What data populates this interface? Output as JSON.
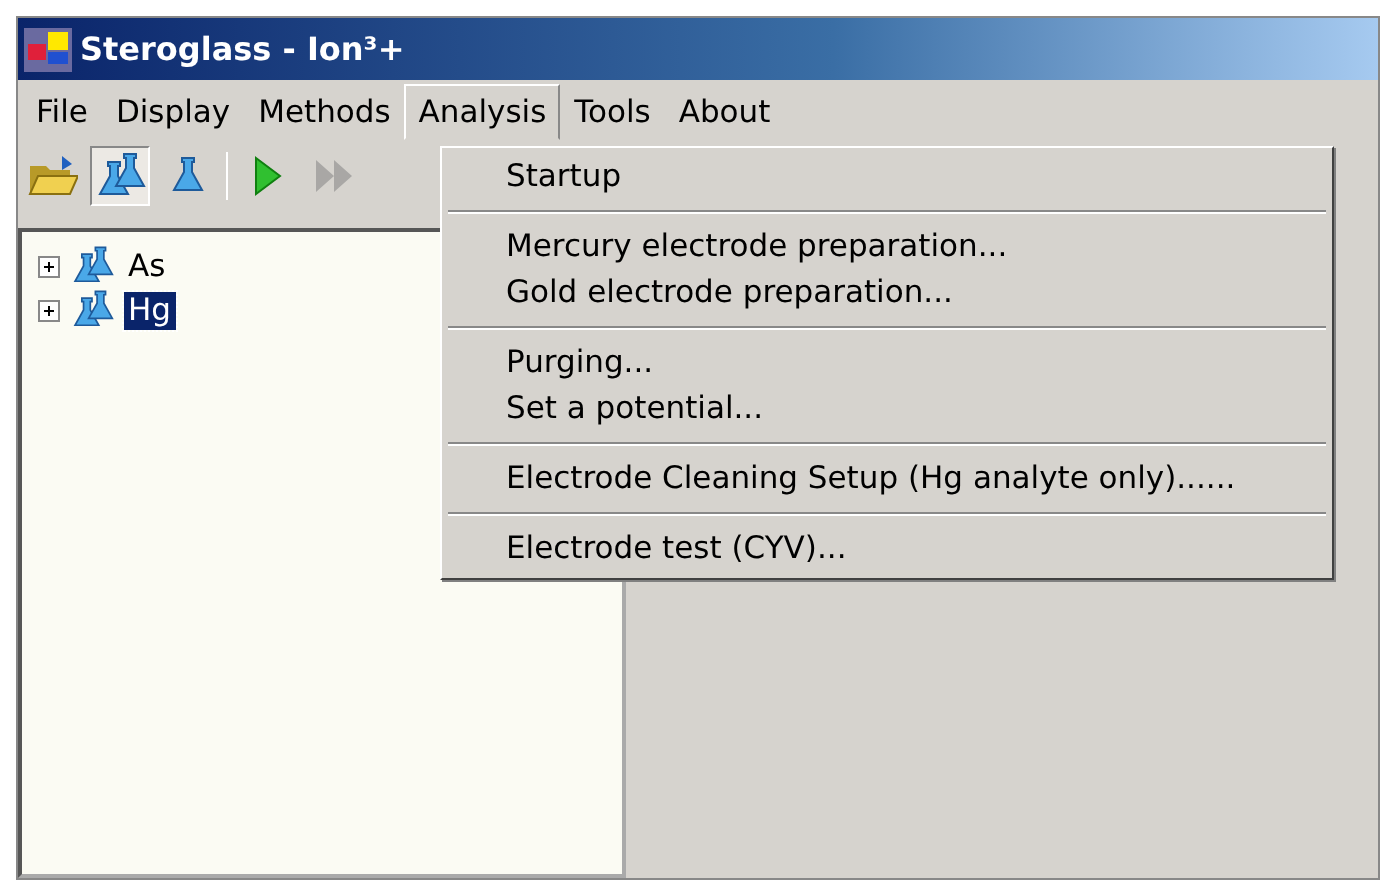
{
  "window": {
    "title": "Steroglass - Ion³+"
  },
  "menubar": [
    {
      "label": "File",
      "selected": false
    },
    {
      "label": "Display",
      "selected": false
    },
    {
      "label": "Methods",
      "selected": false
    },
    {
      "label": "Analysis",
      "selected": true
    },
    {
      "label": "Tools",
      "selected": false
    },
    {
      "label": "About",
      "selected": false
    }
  ],
  "toolbar": [
    {
      "kind": "open",
      "pressed": false,
      "disabled": false
    },
    {
      "kind": "flasks",
      "pressed": true,
      "disabled": false
    },
    {
      "kind": "flask",
      "pressed": false,
      "disabled": false
    },
    {
      "kind": "separator"
    },
    {
      "kind": "play",
      "pressed": false,
      "disabled": false
    },
    {
      "kind": "forward",
      "pressed": false,
      "disabled": true
    }
  ],
  "tree": [
    {
      "label": "As",
      "expanded": false,
      "selected": false
    },
    {
      "label": "Hg",
      "expanded": false,
      "selected": true
    }
  ],
  "dropdown": {
    "groups": [
      [
        "Startup"
      ],
      [
        "Mercury electrode preparation...",
        "Gold electrode preparation..."
      ],
      [
        "Purging...",
        "Set a potential..."
      ],
      [
        "Electrode Cleaning Setup (Hg analyte only)......"
      ],
      [
        "Electrode test (CYV)..."
      ]
    ]
  }
}
